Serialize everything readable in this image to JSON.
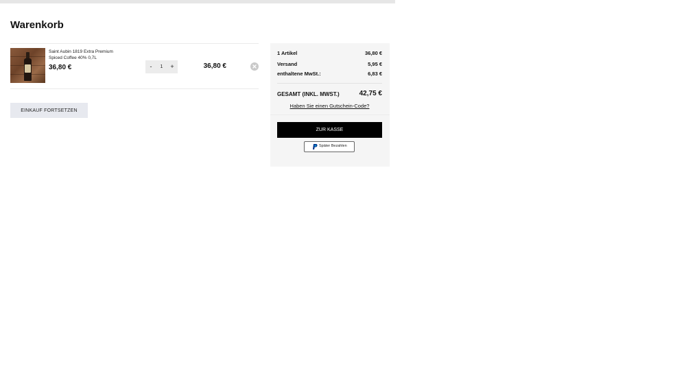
{
  "page": {
    "title": "Warenkorb"
  },
  "cart": {
    "items": [
      {
        "name_line1": "Saint Aubin 1819 Extra Premium",
        "name_line2": "Spiced Coffee 40% 0,7L",
        "unit_price": "36,80 €",
        "quantity": "1",
        "minus_label": "-",
        "plus_label": "+",
        "total_price": "36,80 €"
      }
    ],
    "continue_label": "EINKAUF FORTSETZEN"
  },
  "summary": {
    "rows": [
      {
        "label": "1 Artikel",
        "amount": "36,80 €"
      },
      {
        "label": "Versand",
        "amount": "5,95 €"
      },
      {
        "label": "enthaltene MwSt.:",
        "amount": "6,83 €"
      }
    ],
    "total_label": "GESAMT (INKL. MWST.)",
    "total_amount": "42,75 €",
    "voucher_link": "Haben Sie einen Gutschein-Code?",
    "checkout_label": "ZUR KASSE",
    "paypal_label": "Später Bezahlen"
  },
  "colors": {
    "checkout_bg": "#000000",
    "summary_bg": "#f5f5f5",
    "continue_bg": "#e7e9ef",
    "paypal_blue": "#003087"
  }
}
